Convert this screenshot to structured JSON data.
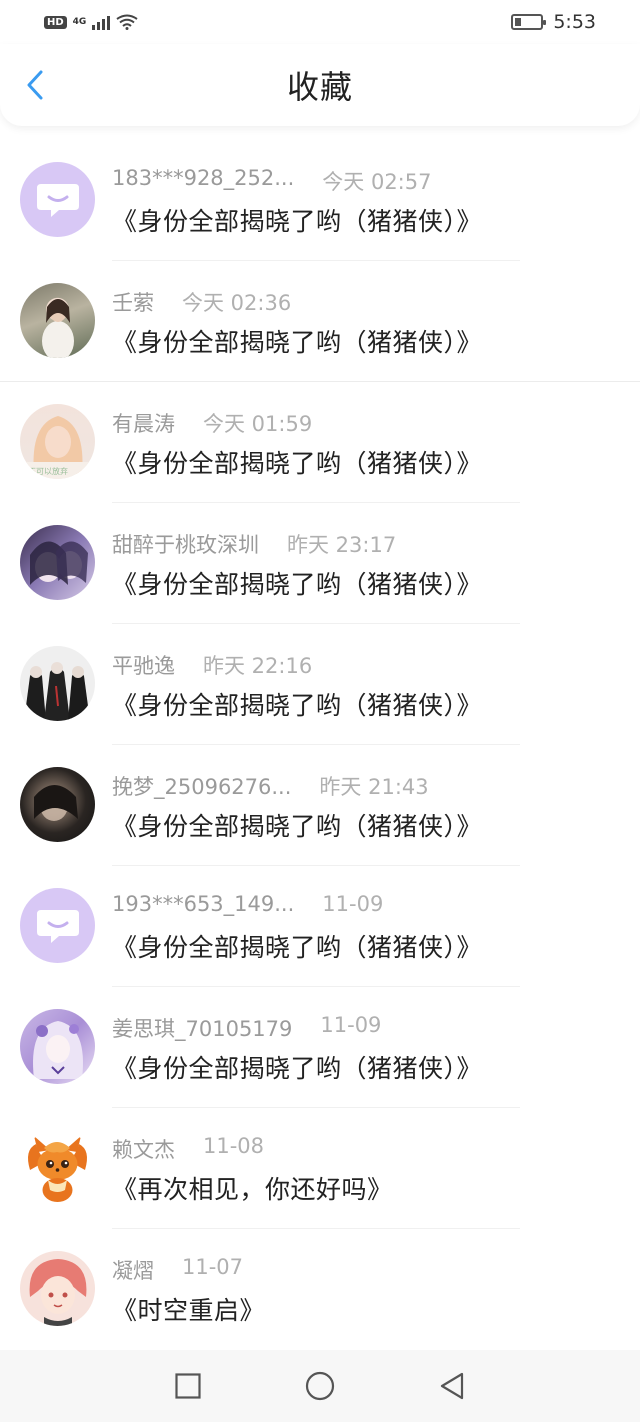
{
  "status": {
    "hd": "HD",
    "network": "4G",
    "time": "5:53"
  },
  "header": {
    "title": "收藏",
    "back_icon": "chevron-left-icon",
    "accent": "#3a9bf0"
  },
  "favorites": [
    {
      "user": "183***928_252...",
      "time": "今天 02:57",
      "work": "《身份全部揭晓了哟（猪猪侠）》",
      "avatar": "default-chat"
    },
    {
      "user": "壬萦",
      "time": "今天 02:36",
      "work": "《身份全部揭晓了哟（猪猪侠）》",
      "avatar": "photo"
    },
    {
      "user": "有晨涛",
      "time": "今天 01:59",
      "work": "《身份全部揭晓了哟（猪猪侠）》",
      "avatar": "photo"
    },
    {
      "user": "甜醉于桃玫深圳",
      "time": "昨天 23:17",
      "work": "《身份全部揭晓了哟（猪猪侠）》",
      "avatar": "photo"
    },
    {
      "user": "平驰逸",
      "time": "昨天 22:16",
      "work": "《身份全部揭晓了哟（猪猪侠）》",
      "avatar": "photo"
    },
    {
      "user": "挽梦_25096276...",
      "time": "昨天 21:43",
      "work": "《身份全部揭晓了哟（猪猪侠）》",
      "avatar": "photo"
    },
    {
      "user": "193***653_149...",
      "time": "11-09",
      "work": "《身份全部揭晓了哟（猪猪侠）》",
      "avatar": "default-chat"
    },
    {
      "user": "姜思琪_70105179",
      "time": "11-09",
      "work": "《身份全部揭晓了哟（猪猪侠）》",
      "avatar": "photo"
    },
    {
      "user": "赖文杰",
      "time": "11-08",
      "work": "《再次相见，你还好吗》",
      "avatar": "cartoon-fox"
    },
    {
      "user": "凝熠",
      "time": "11-07",
      "work": "《时空重启》",
      "avatar": "photo"
    }
  ],
  "navbar": {
    "items": [
      "recents-square-icon",
      "home-circle-icon",
      "back-triangle-icon"
    ]
  }
}
